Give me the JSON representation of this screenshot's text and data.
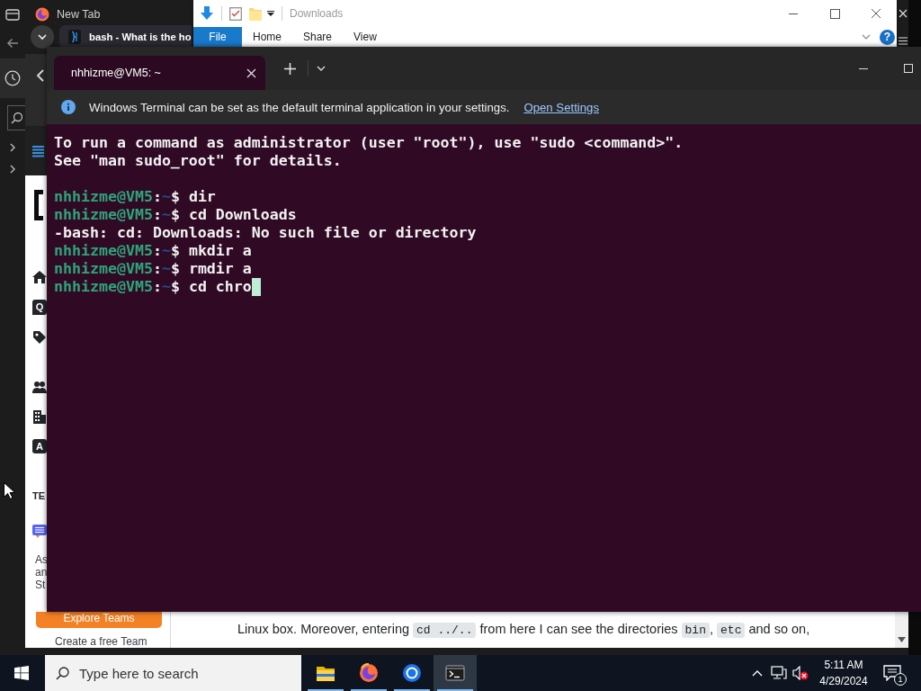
{
  "browser": {
    "tabs": [
      {
        "title": "New Tab",
        "selected": false
      },
      {
        "title": "bash - What is the ho",
        "selected": true
      }
    ],
    "page": {
      "sidebar": {
        "questions_label": "Q",
        "articles_label": "A",
        "teams_heading": "TE",
        "teams_blurb": [
          "As",
          "an",
          "St"
        ],
        "explore_button": "Explore Teams",
        "create_link": "Create a free Team"
      },
      "text_line": [
        {
          "kind": "text",
          "text": "Linux box. Moreover, entering "
        },
        {
          "kind": "code",
          "text": "cd ../.."
        },
        {
          "kind": "text",
          "text": " from here I can see the directories "
        },
        {
          "kind": "code",
          "text": "bin"
        },
        {
          "kind": "text",
          "text": ", "
        },
        {
          "kind": "code",
          "text": "etc"
        },
        {
          "kind": "text",
          "text": " and so on,"
        }
      ]
    }
  },
  "explorer": {
    "title": "Downloads",
    "ribbon": [
      {
        "label": "File",
        "kind": "menu"
      },
      {
        "label": "Home",
        "kind": "tab"
      },
      {
        "label": "Share",
        "kind": "tab"
      },
      {
        "label": "View",
        "kind": "tab"
      }
    ],
    "help": "?"
  },
  "terminal": {
    "tabs": [
      {
        "title": "nhhizme@VM5: ~",
        "selected": true
      }
    ],
    "notice": {
      "text": "Windows Terminal can be set as the default terminal application in your settings.",
      "link": "Open Settings"
    },
    "lines": [
      {
        "kind": "output",
        "text": "To run a command as administrator (user \"root\"), use \"sudo <command>\".",
        "cursor": false
      },
      {
        "kind": "output",
        "text": "See \"man sudo_root\" for details.",
        "cursor": false
      },
      {
        "kind": "blank"
      },
      {
        "kind": "prompt",
        "user": "nhhizme@VM5",
        "separator": ":",
        "path": "~",
        "symbol": "$",
        "command": "dir",
        "cursor": false
      },
      {
        "kind": "prompt",
        "user": "nhhizme@VM5",
        "separator": ":",
        "path": "~",
        "symbol": "$",
        "command": "cd Downloads",
        "cursor": false
      },
      {
        "kind": "output",
        "text": "-bash: cd: Downloads: No such file or directory",
        "cursor": false
      },
      {
        "kind": "prompt",
        "user": "nhhizme@VM5",
        "separator": ":",
        "path": "~",
        "symbol": "$",
        "command": "mkdir a",
        "cursor": false
      },
      {
        "kind": "prompt",
        "user": "nhhizme@VM5",
        "separator": ":",
        "path": "~",
        "symbol": "$",
        "command": "rmdir a",
        "cursor": false
      },
      {
        "kind": "prompt",
        "user": "nhhizme@VM5",
        "separator": ":",
        "path": "~",
        "symbol": "$",
        "command": "cd chro",
        "cursor": true
      }
    ]
  },
  "taskbar": {
    "search": {
      "placeholder": "Type here to search"
    },
    "apps": [
      {
        "kind": "folder",
        "running": true,
        "selected": false
      },
      {
        "kind": "fox",
        "running": true,
        "selected": false
      },
      {
        "kind": "ring",
        "running": true,
        "selected": false
      },
      {
        "kind": "console",
        "running": true,
        "selected": true
      }
    ],
    "volume": {
      "muted": true
    },
    "clock": {
      "time": "5:11 AM",
      "date": "4/29/2024"
    },
    "notifications": {
      "count": "1"
    }
  }
}
